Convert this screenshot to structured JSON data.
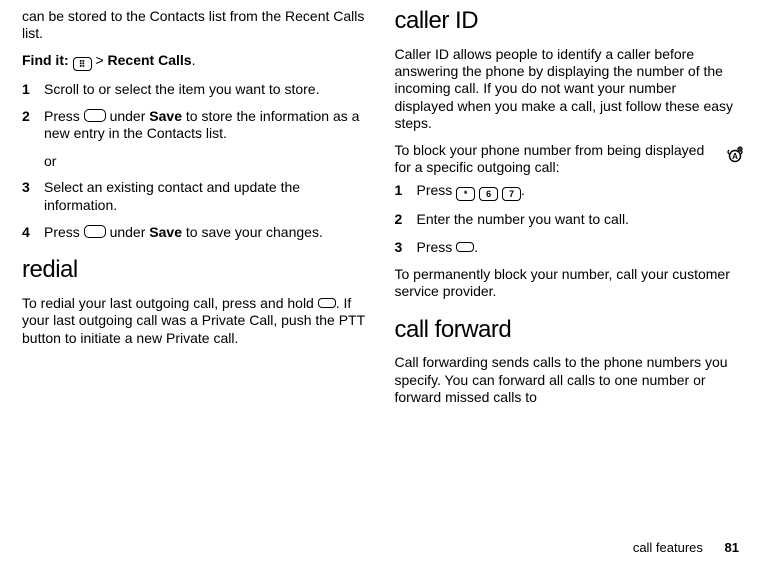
{
  "leftColumn": {
    "intro": "can be stored to the Contacts list from the Recent Calls list.",
    "findIt": {
      "label": "Find it:",
      "sep": ">",
      "target": "Recent Calls",
      "period": "."
    },
    "steps": {
      "1": "Scroll to or select the item you want to store.",
      "2a": "Press ",
      "2b": " under ",
      "2c": "Save",
      "2d": " to store the information as a new entry in the Contacts list.",
      "or": "or",
      "3": "Select an existing contact and update the information.",
      "4a": "Press ",
      "4b": " under ",
      "4c": "Save",
      "4d": " to save your changes."
    },
    "redial": {
      "heading": "redial",
      "p1a": "To redial your last outgoing call, press and hold ",
      "p1b": ". If your last outgoing call was a Private Call, push the PTT button to initiate a new Private call."
    }
  },
  "rightColumn": {
    "callerId": {
      "heading": "caller ID",
      "p1": "Caller ID allows people to identify a caller before answering the phone by displaying the number of the incoming call. If you do not want your number displayed when you make a call, just follow these easy steps.",
      "p2": "To block your phone number from being displayed for a specific outgoing call:",
      "steps": {
        "1a": "Press ",
        "1b": ".",
        "2": "Enter the number you want to call.",
        "3a": "Press ",
        "3b": "."
      },
      "p3": "To permanently block your number, call your customer service provider."
    },
    "callForward": {
      "heading": "call forward",
      "p1": "Call forwarding sends calls to the phone numbers you specify. You can forward all calls to one number or forward missed calls to"
    }
  },
  "keys": {
    "star": "*",
    "six": "6",
    "seven": "7",
    "menu": "⠿"
  },
  "footer": {
    "section": "call features",
    "page": "81"
  }
}
